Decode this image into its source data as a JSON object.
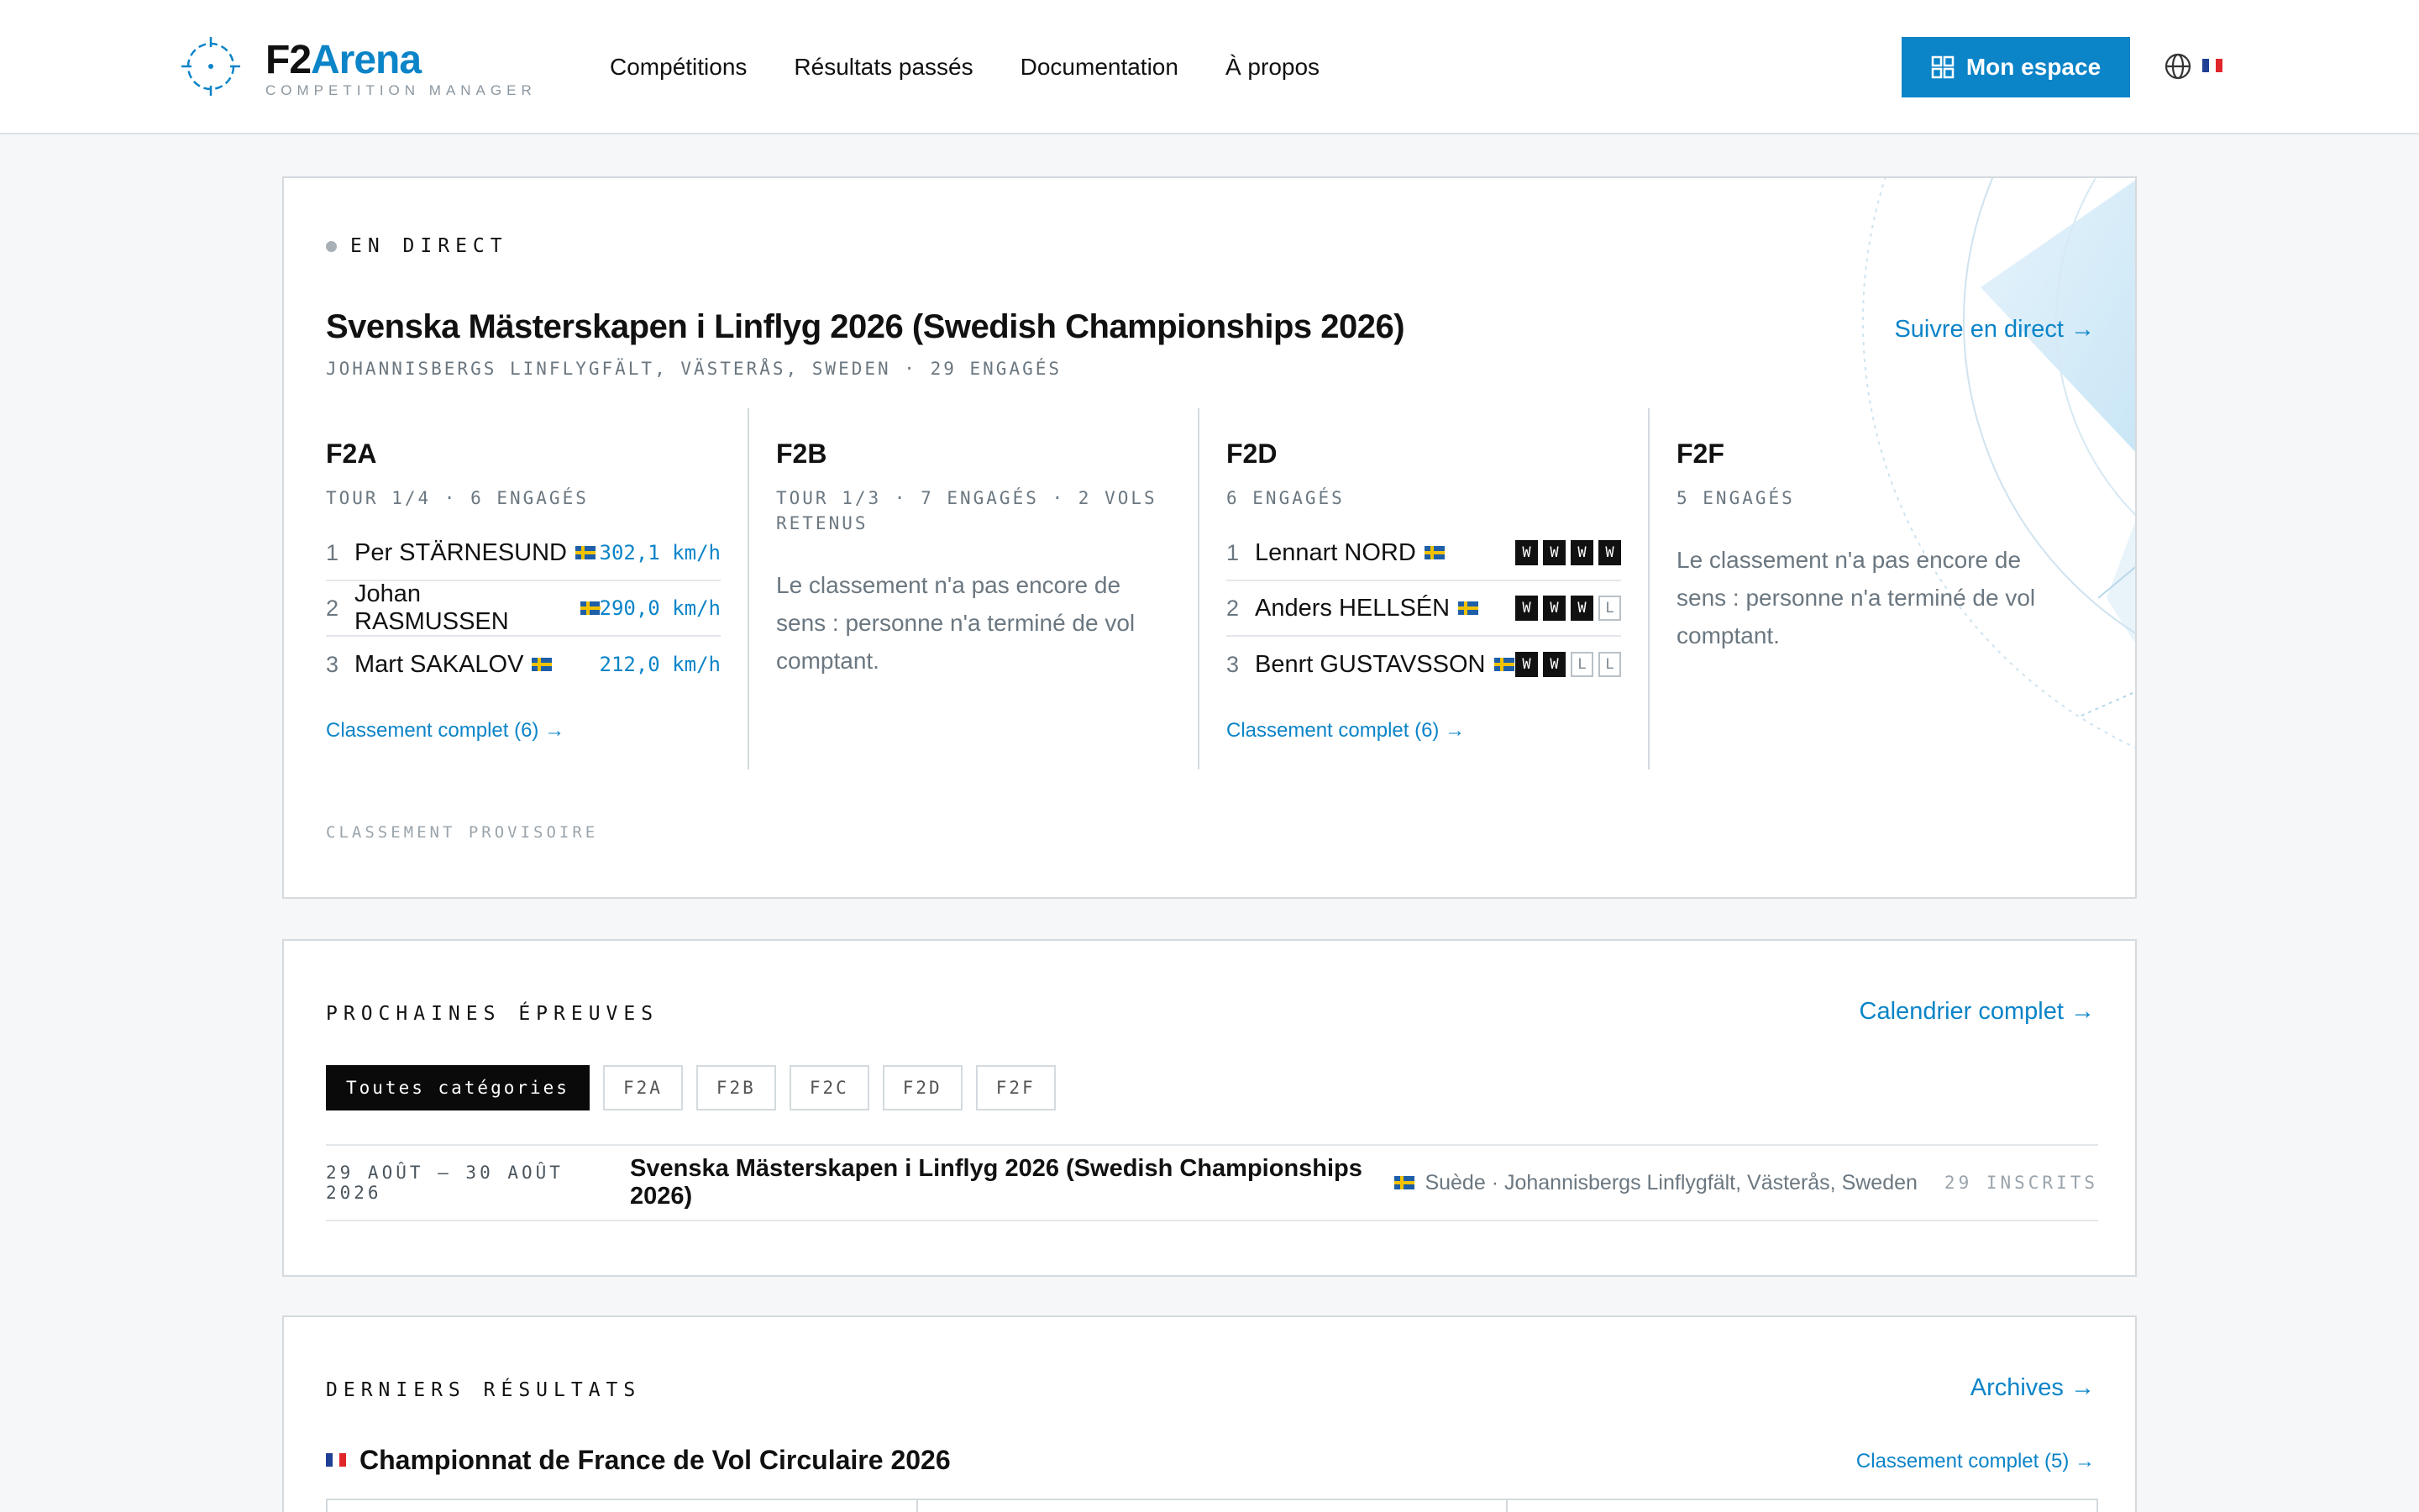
{
  "header": {
    "logo_f2": "F2",
    "logo_arena": "Arena",
    "logo_sub": "COMPETITION MANAGER",
    "nav": [
      "Compétitions",
      "Résultats passés",
      "Documentation",
      "À propos"
    ],
    "cta": "Mon espace",
    "flag_colors": [
      "#1f3f95",
      "#ffffff",
      "#e1262b"
    ]
  },
  "live": {
    "badge": "EN DIRECT",
    "title": "Svenska Mästerskapen i Linflyg 2026 (Swedish Championships 2026)",
    "subtitle": "JOHANNISBERGS LINFLYGFÄLT, VÄSTERÅS, SWEDEN · 29 ENGAGÉS",
    "follow": "Suivre en direct →",
    "columns": {
      "f2a": {
        "name": "F2A",
        "meta": "TOUR 1/4 · 6 ENGAGÉS",
        "rows": [
          {
            "pos": "1",
            "name": "Per STÄRNESUND",
            "value": "302,1 km/h"
          },
          {
            "pos": "2",
            "name": "Johan RASMUSSEN",
            "value": "290,0 km/h"
          },
          {
            "pos": "3",
            "name": "Mart SAKALOV",
            "value": "212,0 km/h"
          }
        ],
        "link": "Classement complet (6) →"
      },
      "f2b": {
        "name": "F2B",
        "meta": "TOUR 1/3 · 7 ENGAGÉS · 2 VOLS RETENUS",
        "empty": "Le classement n'a pas encore de sens : personne n'a terminé de vol comptant."
      },
      "f2d": {
        "name": "F2D",
        "meta": "6 ENGAGÉS",
        "rows": [
          {
            "pos": "1",
            "name": "Lennart NORD",
            "results": [
              "W",
              "W",
              "W",
              "W"
            ]
          },
          {
            "pos": "2",
            "name": "Anders HELLSÉN",
            "results": [
              "W",
              "W",
              "W",
              "L"
            ]
          },
          {
            "pos": "3",
            "name": "Benrt GUSTAVSSON",
            "results": [
              "W",
              "W",
              "L",
              "L"
            ]
          }
        ],
        "link": "Classement complet (6) →"
      },
      "f2f": {
        "name": "F2F",
        "meta": "5 ENGAGÉS",
        "empty": "Le classement n'a pas encore de sens : personne n'a terminé de vol comptant."
      }
    },
    "footnote": "CLASSEMENT PROVISOIRE"
  },
  "upcoming": {
    "title": "PROCHAINES ÉPREUVES",
    "link": "Calendrier complet →",
    "chips": [
      "Toutes catégories",
      "F2A",
      "F2B",
      "F2C",
      "F2D",
      "F2F"
    ],
    "event": {
      "date": "29 AOÛT — 30 AOÛT 2026",
      "name": "Svenska Mästerskapen i Linflyg 2026 (Swedish Championships 2026)",
      "location": "Suède · Johannisbergs Linflygfält, Västerås, Sweden",
      "count": "29 INSCRITS"
    }
  },
  "results": {
    "title": "DERNIERS RÉSULTATS",
    "link": "Archives →",
    "event_title": "Championnat de France de Vol Circulaire 2026",
    "event_link": "Classement complet (5) →"
  }
}
